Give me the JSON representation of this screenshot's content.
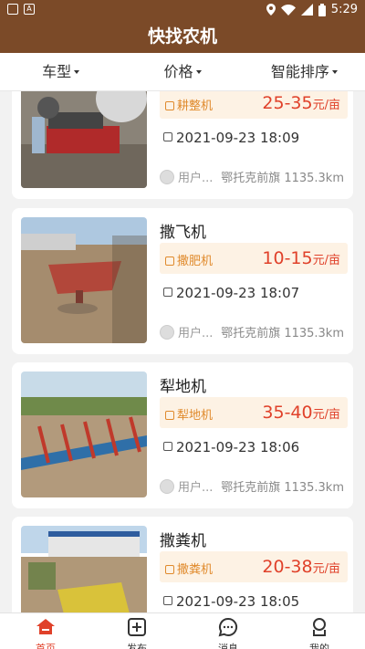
{
  "status_bar": {
    "time": "5:29",
    "left_icons": [
      "image-icon",
      "a-icon"
    ],
    "right_icons": [
      "location-icon",
      "wifi-icon",
      "signal-icon",
      "battery-icon"
    ]
  },
  "title": "快找农机",
  "filters": [
    {
      "label": "车型"
    },
    {
      "label": "价格"
    },
    {
      "label": "智能排序"
    }
  ],
  "listings": [
    {
      "name": "",
      "tag": "耕整机",
      "price": "25-35",
      "unit": "元/亩",
      "date": "2021-09-23 18:09",
      "user": "用户...",
      "location": "鄂托克前旗 1135.3km"
    },
    {
      "name": "撒飞机",
      "tag": "撒肥机",
      "price": "10-15",
      "unit": "元/亩",
      "date": "2021-09-23 18:07",
      "user": "用户...",
      "location": "鄂托克前旗 1135.3km"
    },
    {
      "name": "犁地机",
      "tag": "犁地机",
      "price": "35-40",
      "unit": "元/亩",
      "date": "2021-09-23 18:06",
      "user": "用户...",
      "location": "鄂托克前旗 1135.3km"
    },
    {
      "name": "撒粪机",
      "tag": "撒粪机",
      "price": "20-38",
      "unit": "元/亩",
      "date": "2021-09-23 18:05",
      "user": "",
      "location": ""
    }
  ],
  "tabs": [
    {
      "label": "首页",
      "icon": "home-icon",
      "active": true
    },
    {
      "label": "发布",
      "icon": "publish-icon",
      "active": false
    },
    {
      "label": "消息",
      "icon": "message-icon",
      "active": false
    },
    {
      "label": "我的",
      "icon": "profile-icon",
      "active": false
    }
  ],
  "colors": {
    "brand": "#7b4a28",
    "price": "#e0412a",
    "tag": "#e08a2c",
    "tag_bg": "#fdf2e4"
  }
}
